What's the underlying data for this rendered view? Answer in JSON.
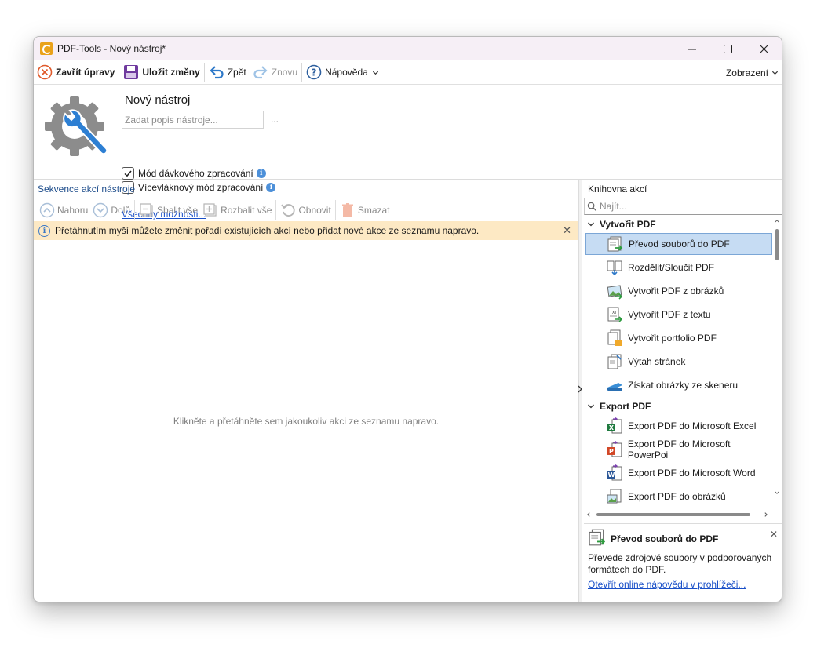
{
  "window": {
    "title": "PDF-Tools - Nový nástroj*"
  },
  "toolbar": {
    "close_edit": "Zavřít úpravy",
    "save_changes": "Uložit změny",
    "undo": "Zpět",
    "redo": "Znovu",
    "help": "Nápověda",
    "view": "Zobrazení"
  },
  "tool": {
    "name": "Nový nástroj",
    "description_placeholder": "Zadat popis nástroje...",
    "description_value": "",
    "more_button": "...",
    "batch_mode": {
      "label": "Mód dávkového zpracování",
      "checked": true
    },
    "multithread_mode": {
      "label": "Vícevláknový mód zpracování",
      "checked": false
    },
    "all_options_link": "Všechny možnosti..."
  },
  "sequence": {
    "title": "Sekvence akcí nástroje",
    "buttons": {
      "up": "Nahoru",
      "down": "Dolů",
      "collapse_all": "Sbalit vše",
      "expand_all": "Rozbalit vše",
      "refresh": "Obnovit",
      "delete": "Smazat"
    },
    "banner": "Přetáhnutím myší můžete změnit pořadí existujících akcí nebo přidat nové akce ze seznamu napravo.",
    "empty_hint": "Klikněte a přetáhněte sem jakoukoliv akci ze seznamu napravo."
  },
  "library": {
    "title": "Knihovna akcí",
    "search_placeholder": "Najít...",
    "groups": [
      {
        "name": "Vytvořit PDF",
        "items": [
          {
            "label": "Převod souborů do PDF",
            "icon": "convert-to-pdf-icon",
            "selected": true
          },
          {
            "label": "Rozdělit/Sloučit PDF",
            "icon": "split-merge-icon",
            "selected": false
          },
          {
            "label": "Vytvořit PDF z obrázků",
            "icon": "pdf-from-images-icon",
            "selected": false
          },
          {
            "label": "Vytvořit PDF z textu",
            "icon": "pdf-from-text-icon",
            "selected": false
          },
          {
            "label": "Vytvořit portfolio PDF",
            "icon": "pdf-portfolio-icon",
            "selected": false
          },
          {
            "label": "Výtah stránek",
            "icon": "extract-pages-icon",
            "selected": false
          },
          {
            "label": "Získat obrázky ze skeneru",
            "icon": "scanner-icon",
            "selected": false
          }
        ]
      },
      {
        "name": "Export PDF",
        "items": [
          {
            "label": "Export PDF do Microsoft Excel",
            "icon": "excel-icon",
            "selected": false
          },
          {
            "label": "Export PDF do Microsoft PowerPoi",
            "icon": "powerpoint-icon",
            "selected": false
          },
          {
            "label": "Export PDF do Microsoft Word",
            "icon": "word-icon",
            "selected": false
          },
          {
            "label": "Export PDF do obrázků",
            "icon": "export-images-icon",
            "selected": false
          }
        ]
      }
    ]
  },
  "details": {
    "title": "Převod souborů do PDF",
    "text": "Převede zdrojové soubory v podporovaných formátech do PDF.",
    "help_link": "Otevřít online nápovědu v prohlížeči..."
  },
  "colors": {
    "accent": "#1a50c8",
    "banner_bg": "#fde9c4",
    "selected_bg": "#c6dcf3",
    "titlebar_bg": "#f6eff6"
  }
}
